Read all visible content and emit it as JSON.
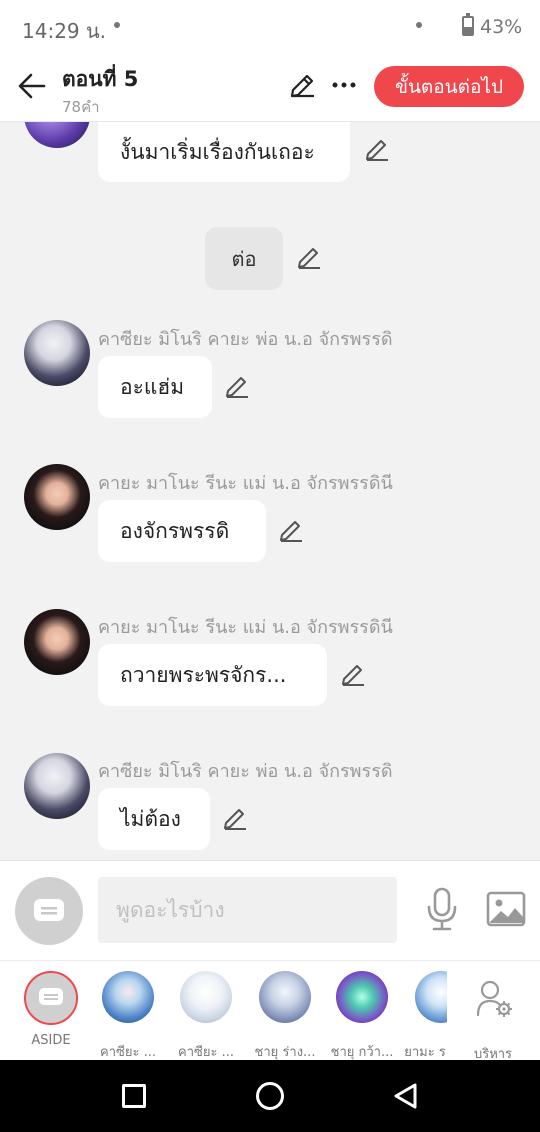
{
  "status_bar": {
    "time": "14:29 น.",
    "battery_percent": "43%",
    "battery_level": 0.43
  },
  "header": {
    "title": "ตอนที่ 5",
    "word_count": "78คำ",
    "next_button": "ขั้นตอนต่อไป",
    "icons": [
      "back-arrow-icon",
      "pencil-icon",
      "more-icon"
    ]
  },
  "messages": [
    {
      "type": "dialogue",
      "text": "งั้นมาเริ่มเรื่องกันเถอะ",
      "speaker": ""
    },
    {
      "type": "narration",
      "text": "ต่อ"
    },
    {
      "type": "dialogue",
      "speaker": "คาซียะ มิโนริ คายะ พ่อ น.อ จักรพรรดิ",
      "text": "อะแฮ่ม"
    },
    {
      "type": "dialogue",
      "speaker": "คายะ มาโนะ รีนะ แม่ น.อ จักรพรรดินี",
      "text": "องจักรพรรดิ"
    },
    {
      "type": "dialogue",
      "speaker": "คายะ มาโนะ รีนะ แม่ น.อ จักรพรรดินี",
      "text": "ถวายพระพรจักร..."
    },
    {
      "type": "dialogue",
      "speaker": "คาซียะ มิโนริ คายะ พ่อ น.อ จักรพรรดิ",
      "text": "ไม่ต้อง"
    }
  ],
  "input": {
    "placeholder": "พูดอะไรบ้าง"
  },
  "characters": {
    "aside_label": "ASIDE",
    "items": [
      {
        "label": "คาซียะ ..."
      },
      {
        "label": "คาซียะ ..."
      },
      {
        "label": "ชายุ ร่าง..."
      },
      {
        "label": "ชายุ กว้า..."
      },
      {
        "label": "ยามะ ร"
      }
    ],
    "manage_label": "บริหาร"
  },
  "colors": {
    "accent": "#f0474d",
    "background": "#f2f2f2",
    "bubble": "#ffffff"
  }
}
